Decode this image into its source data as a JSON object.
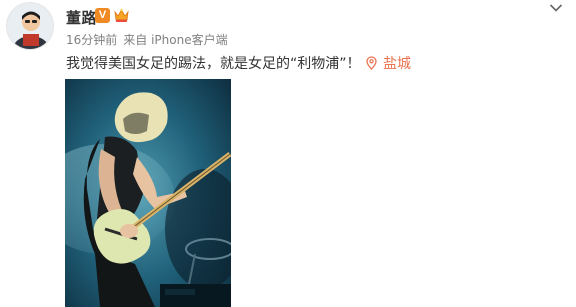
{
  "author": {
    "name": "董路",
    "verified_badge": "V",
    "badge_color": "#f08a24"
  },
  "meta": {
    "time": "16分钟前",
    "source": "来自 iPhone客户端"
  },
  "post": {
    "text": "我觉得美国女足的踢法，就是女足的“利物浦”！",
    "location": "盐城",
    "location_icon": "map-pin-icon",
    "accent_color": "#eb7350"
  },
  "icons": {
    "more": "chevron-down-icon",
    "vip": "crown-icon"
  }
}
